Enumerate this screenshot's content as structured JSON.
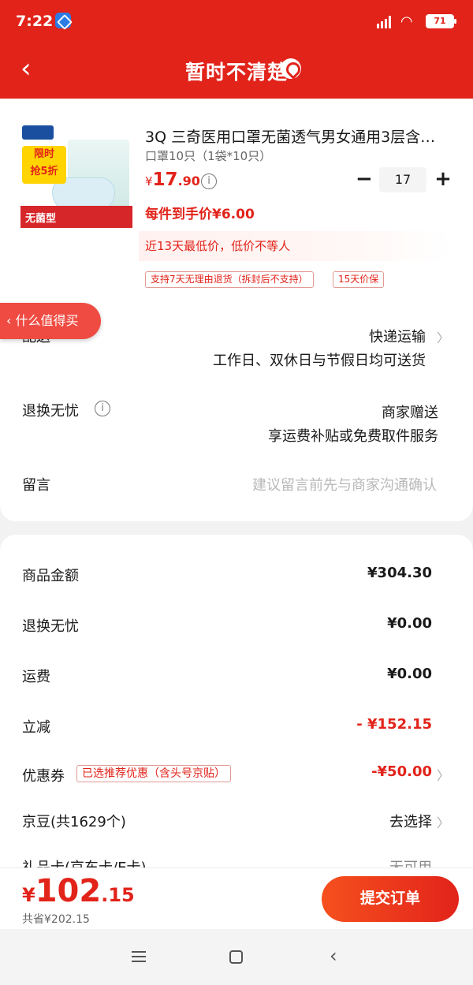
{
  "status": {
    "time": "7:22",
    "battery": "71"
  },
  "nav": {
    "title": "暂时不清楚"
  },
  "product": {
    "title": "3Q 三奇医用口罩无菌透气男女通用3层含…",
    "spec": "口罩10只（1袋*10只）",
    "price_currency": "¥",
    "price_int": "17",
    "price_dec": ".90",
    "quantity": "17",
    "unit_price": "每件到手价¥6.00",
    "lowest_note": "近13天最低价，低价不等人",
    "badges": [
      "支持7天无理由退货（拆封后不支持）",
      "15天价保"
    ],
    "image_text": {
      "sale_top": "限时",
      "sale_main": "抢5折",
      "tag": "无菌型",
      "brand": "3Q"
    }
  },
  "float_pill": "什么值得买",
  "delivery": {
    "label": "配送",
    "method": "快递运输",
    "time": "工作日、双休日与节假日均可送货"
  },
  "returns": {
    "label": "退换无忧",
    "value1": "商家赠送",
    "value2": "享运费补贴或免费取件服务"
  },
  "message": {
    "label": "留言",
    "placeholder": "建议留言前先与商家沟通确认"
  },
  "summary": {
    "goods_label": "商品金额",
    "goods_value": "¥304.30",
    "returns_label": "退换无忧",
    "returns_value": "¥0.00",
    "shipping_label": "运费",
    "shipping_value": "¥0.00",
    "discount_label": "立减",
    "discount_value": "- ¥152.15",
    "coupon_label": "优惠券",
    "coupon_tag": "已选推荐优惠（含头号京贴）",
    "coupon_value": "-¥50.00",
    "beans_label": "京豆(共1629个)",
    "beans_action": "去选择",
    "card_label": "礼品卡(京东卡/E卡)",
    "card_value": "无可用"
  },
  "bottom": {
    "currency": "¥",
    "total_int": "102",
    "total_dec": ".15",
    "saved": "共省¥202.15",
    "submit": "提交订单"
  }
}
